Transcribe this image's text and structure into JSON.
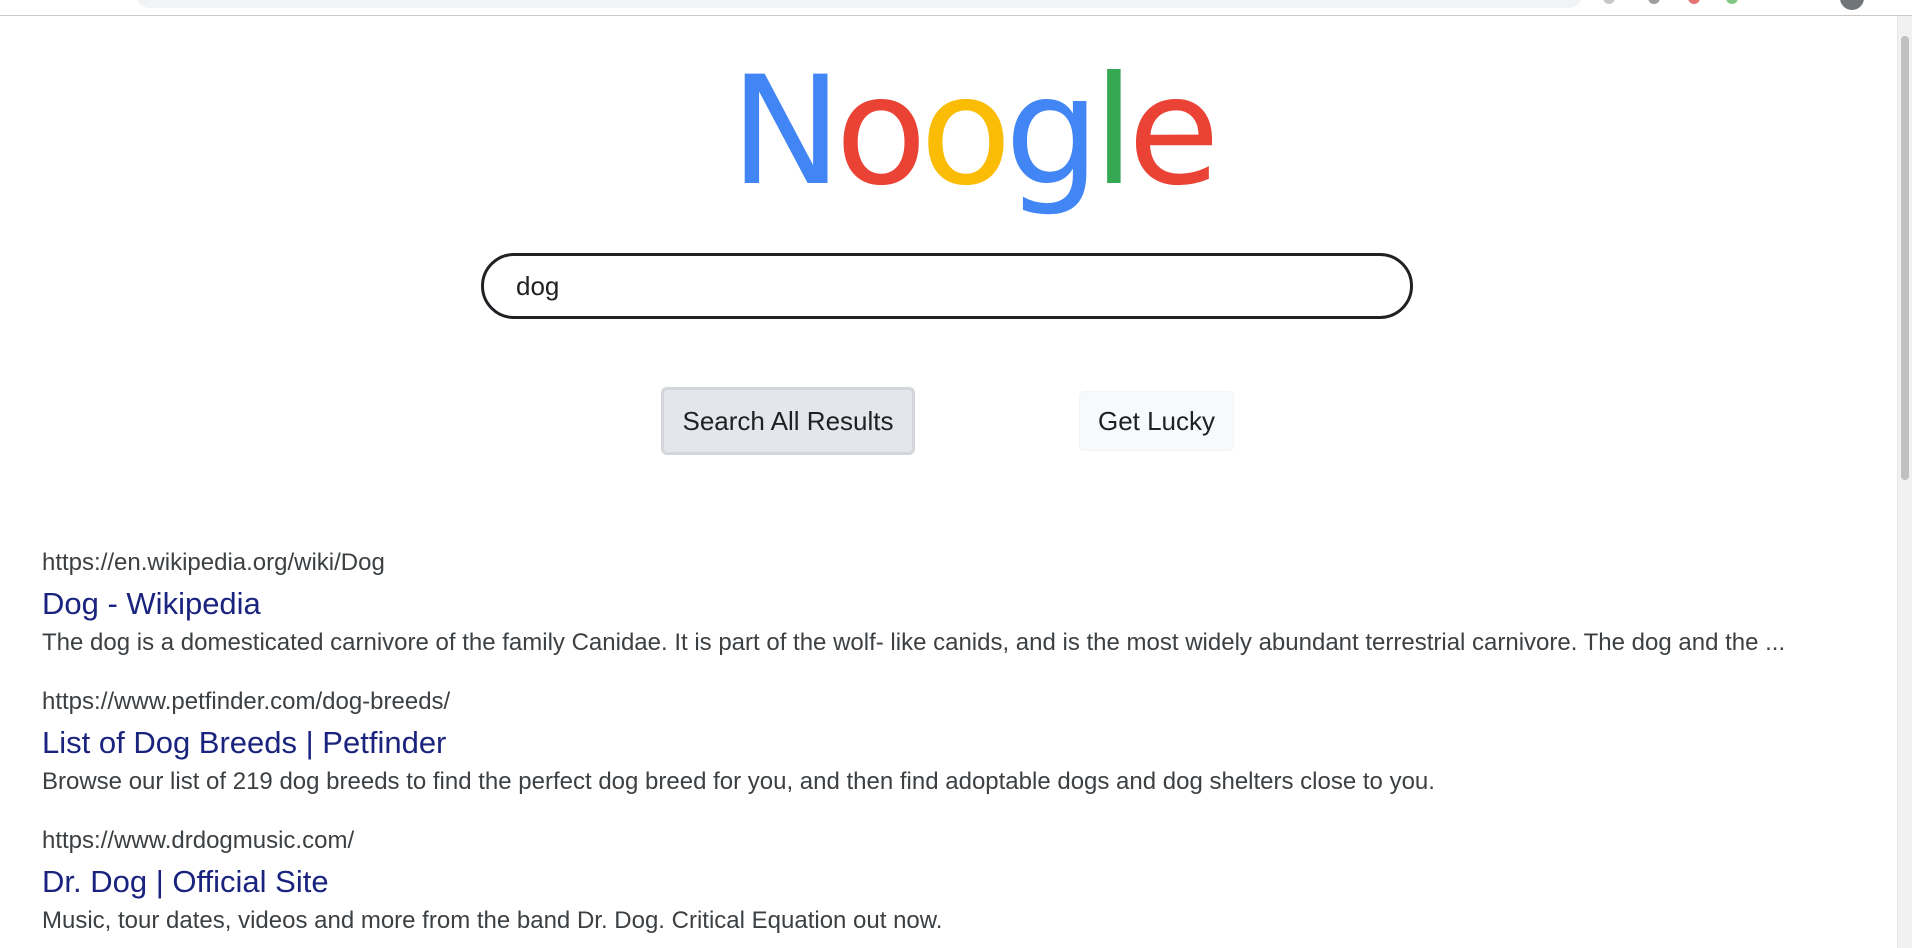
{
  "colors": {
    "logo_blue": "#4285f4",
    "logo_red": "#ea4335",
    "logo_yellow": "#fbbc05",
    "logo_green": "#34a853",
    "result_title": "#1a237e",
    "text": "#3c4043"
  },
  "logo": {
    "letters": [
      "N",
      "o",
      "o",
      "g",
      "l",
      "e"
    ]
  },
  "search": {
    "value": "dog",
    "search_button_label": "Search All Results",
    "lucky_button_label": "Get Lucky"
  },
  "results": [
    {
      "url": "https://en.wikipedia.org/wiki/Dog",
      "title": "Dog - Wikipedia",
      "snippet": "The dog is a domesticated carnivore of the family Canidae. It is part of the wolf- like canids, and is the most widely abundant terrestrial carnivore. The dog and the ..."
    },
    {
      "url": "https://www.petfinder.com/dog-breeds/",
      "title": "List of Dog Breeds | Petfinder",
      "snippet": "Browse our list of 219 dog breeds to find the perfect dog breed for you, and then find adoptable dogs and dog shelters close to you."
    },
    {
      "url": "https://www.drdogmusic.com/",
      "title": "Dr. Dog | Official Site",
      "snippet": "Music, tour dates, videos and more from the band Dr. Dog. Critical Equation out now."
    }
  ]
}
